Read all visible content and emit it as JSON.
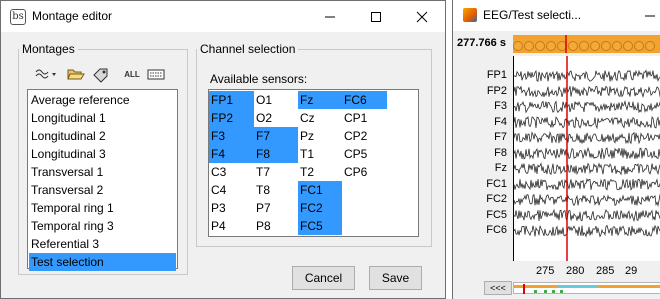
{
  "montage_window": {
    "title": "Montage editor",
    "montages_group": {
      "legend": "Montages",
      "toolbar_icons": [
        "waveform-dropdown-icon",
        "folder-open-icon",
        "tag-icon",
        "all-text-icon",
        "keyboard-icon"
      ],
      "all_label": "ALL",
      "items": [
        "Average reference",
        "Longitudinal 1",
        "Longitudinal 2",
        "Longitudinal 3",
        "Transversal 1",
        "Transversal 2",
        "Temporal ring 1",
        "Temporal ring 3",
        "Referential 3",
        "Test selection"
      ],
      "selected": "Test selection"
    },
    "channel_selection": {
      "legend": "Channel selection",
      "label": "Available sensors:",
      "columns": [
        [
          {
            "name": "FP1",
            "sel": true
          },
          {
            "name": "FP2",
            "sel": true
          },
          {
            "name": "F3",
            "sel": true
          },
          {
            "name": "F4",
            "sel": true
          },
          {
            "name": "C3",
            "sel": false
          },
          {
            "name": "C4",
            "sel": false
          },
          {
            "name": "P3",
            "sel": false
          },
          {
            "name": "P4",
            "sel": false
          }
        ],
        [
          {
            "name": "O1",
            "sel": false
          },
          {
            "name": "O2",
            "sel": false
          },
          {
            "name": "F7",
            "sel": true
          },
          {
            "name": "F8",
            "sel": true
          },
          {
            "name": "T7",
            "sel": false
          },
          {
            "name": "T8",
            "sel": false
          },
          {
            "name": "P7",
            "sel": false
          },
          {
            "name": "P8",
            "sel": false
          }
        ],
        [
          {
            "name": "Fz",
            "sel": true
          },
          {
            "name": "Cz",
            "sel": false
          },
          {
            "name": "Pz",
            "sel": false
          },
          {
            "name": "T1",
            "sel": false
          },
          {
            "name": "T2",
            "sel": false
          },
          {
            "name": "FC1",
            "sel": true
          },
          {
            "name": "FC2",
            "sel": true
          },
          {
            "name": "FC5",
            "sel": true
          }
        ],
        [
          {
            "name": "FC6",
            "sel": true
          },
          {
            "name": "CP1",
            "sel": false
          },
          {
            "name": "CP2",
            "sel": false
          },
          {
            "name": "CP5",
            "sel": false
          },
          {
            "name": "CP6",
            "sel": false
          }
        ]
      ]
    },
    "buttons": {
      "cancel": "Cancel",
      "save": "Save"
    }
  },
  "eeg_window": {
    "title": "EEG/Test selecti...",
    "time_readout": "277.766 s",
    "channels": [
      "FP1",
      "FP2",
      "F3",
      "F4",
      "F7",
      "F8",
      "Fz",
      "FC1",
      "FC2",
      "FC5",
      "FC6"
    ],
    "x_ticks": [
      "275",
      "280",
      "285",
      "29"
    ],
    "nav_label": "<<<",
    "colors": {
      "events": "#f2a32f",
      "cursor": "#e00000",
      "selection": "#3399ff",
      "signal": "#2a2a2a"
    }
  }
}
